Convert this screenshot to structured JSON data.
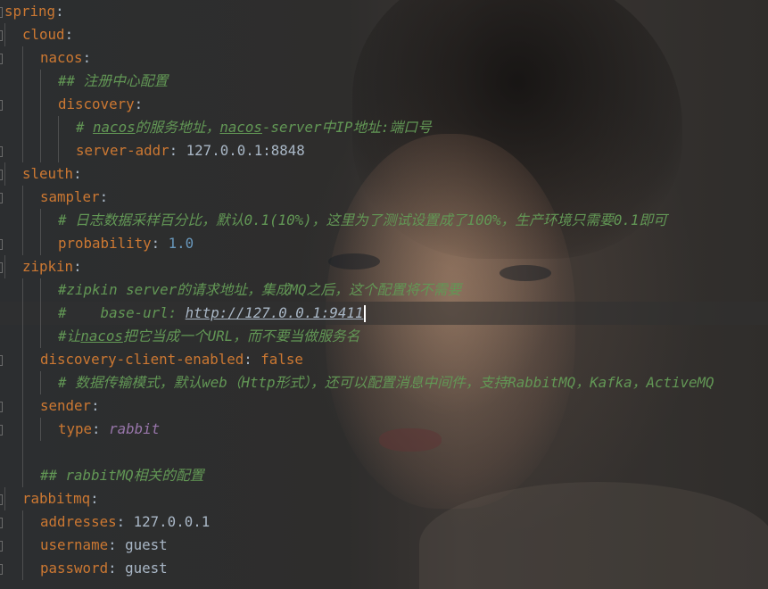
{
  "lines": {
    "l1": {
      "key": "spring",
      "colon": ":"
    },
    "l2": {
      "key": "cloud",
      "colon": ":"
    },
    "l3": {
      "key": "nacos",
      "colon": ":"
    },
    "l4": {
      "comment": "## 注册中心配置"
    },
    "l5": {
      "key": "discovery",
      "colon": ":"
    },
    "l6": {
      "c1": "# ",
      "u1": "nacos",
      "c2": "的服务地址，",
      "u2": "nacos",
      "c3": "-server中IP地址:端口号"
    },
    "l7": {
      "key": "server-addr",
      "colon": ": ",
      "value": "127.0.0.1:8848"
    },
    "l8": {
      "key": "sleuth",
      "colon": ":"
    },
    "l9": {
      "key": "sampler",
      "colon": ":"
    },
    "l10": {
      "comment": "# 日志数据采样百分比，默认0.1(10%)，这里为了测试设置成了100%，生产环境只需要0.1即可"
    },
    "l11": {
      "key": "probability",
      "colon": ": ",
      "value": "1.0"
    },
    "l12": {
      "key": "zipkin",
      "colon": ":"
    },
    "l13": {
      "comment": "#zipkin server的请求地址，集成MQ之后，这个配置将不需要"
    },
    "l14": {
      "prefix": "#    base-url: ",
      "url": "http://127.0.0.1:9411"
    },
    "l15": {
      "c1": "#让",
      "u1": "nacos",
      "c2": "把它当成一个URL，而不要当做服务名"
    },
    "l16": {
      "key": "discovery-client-enabled",
      "colon": ": ",
      "value": "false"
    },
    "l17": {
      "comment": "# 数据传输模式，默认web（Http形式），还可以配置消息中间件，支持RabbitMQ，Kafka，ActiveMQ"
    },
    "l18": {
      "key": "sender",
      "colon": ":"
    },
    "l19": {
      "key": "type",
      "colon": ": ",
      "value": "rabbit"
    },
    "l21": {
      "comment": "## rabbitMQ相关的配置"
    },
    "l22": {
      "key": "rabbitmq",
      "colon": ":"
    },
    "l23": {
      "key": "addresses",
      "colon": ": ",
      "value": "127.0.0.1"
    },
    "l24": {
      "key": "username",
      "colon": ": ",
      "value": "guest"
    },
    "l25": {
      "key": "password",
      "colon": ": ",
      "value": "guest"
    }
  },
  "colors": {
    "background": "#2b2b2b",
    "key": "#cc7832",
    "text": "#a9b7c6",
    "number": "#6897bb",
    "constant": "#9876aa",
    "comment": "#629755"
  }
}
